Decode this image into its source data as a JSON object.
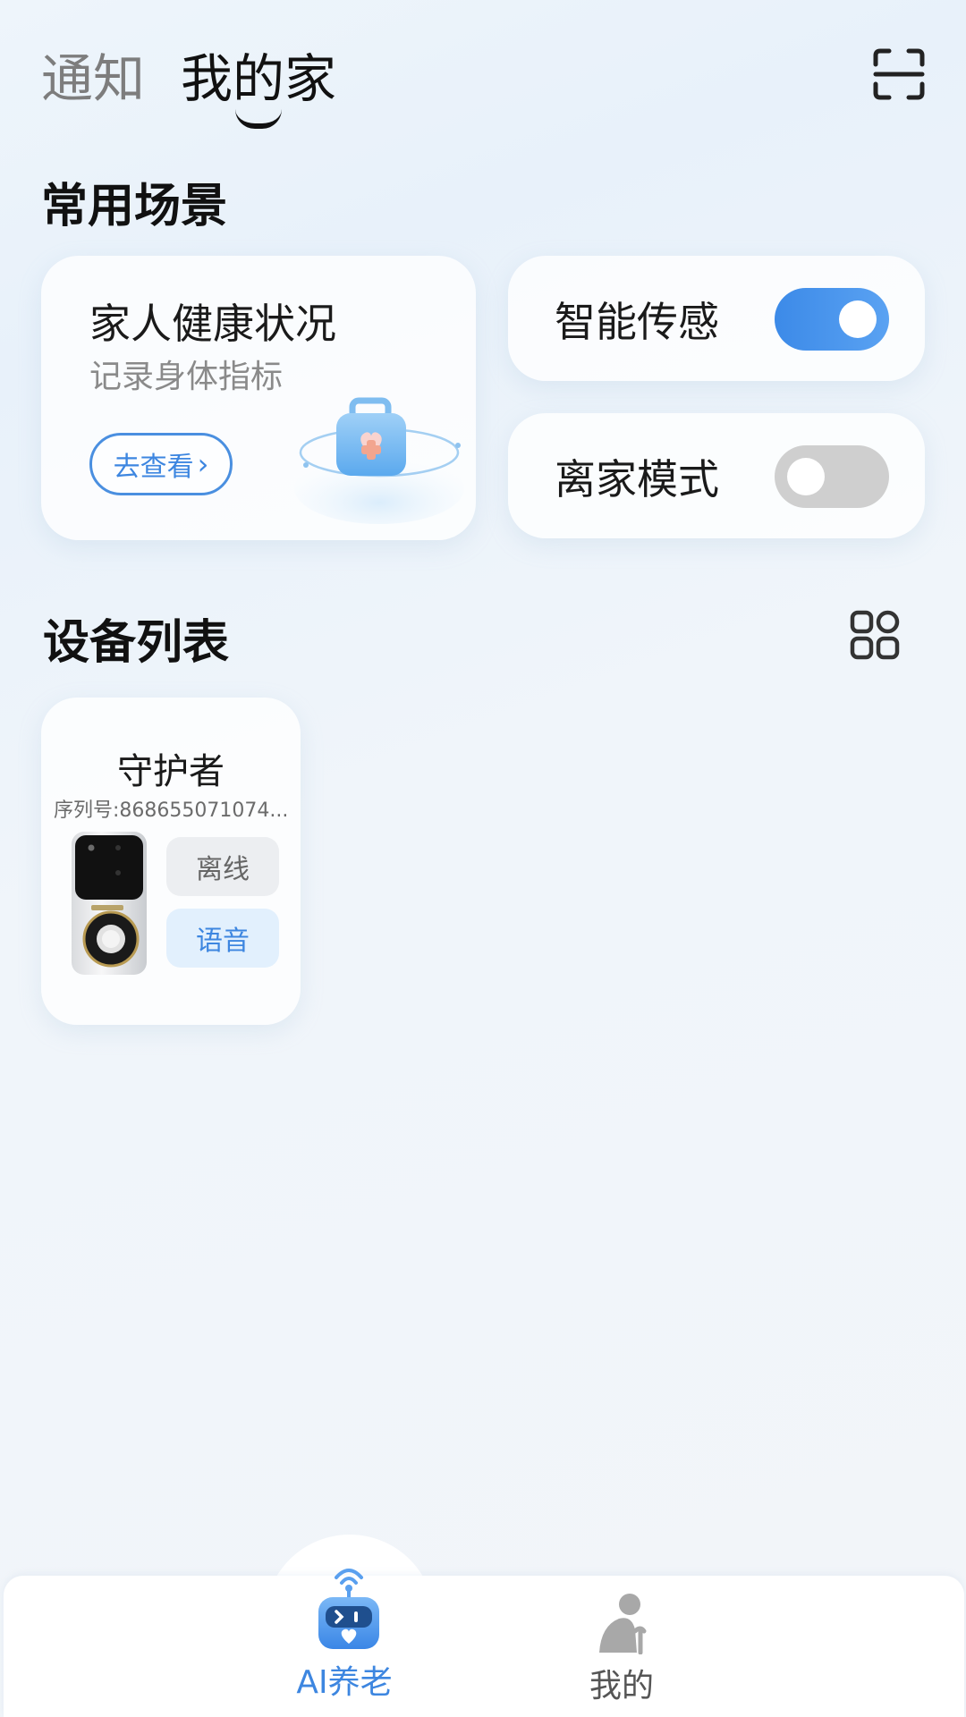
{
  "header": {
    "tab_notify": "通知",
    "tab_home": "我的家",
    "scan_icon": "scan-icon"
  },
  "scenes": {
    "title": "常用场景",
    "health_card": {
      "title": "家人健康状况",
      "subtitle": "记录身体指标",
      "button_label": "去查看",
      "illustration_icon": "medical-kit-icon"
    },
    "switches": [
      {
        "label": "智能传感",
        "state": "on"
      },
      {
        "label": "离家模式",
        "state": "off"
      }
    ]
  },
  "devices": {
    "title": "设备列表",
    "layout_icon": "grid-view-icon",
    "items": [
      {
        "name": "守护者",
        "serial": "序列号:868655071074...",
        "status": "离线",
        "voice_label": "语音",
        "image_icon": "doorbell-camera-icon"
      }
    ]
  },
  "bottom_nav": {
    "items": [
      {
        "label": "AI养老",
        "icon": "robot-icon",
        "active": true
      },
      {
        "label": "我的",
        "icon": "elder-person-icon",
        "active": false
      }
    ]
  },
  "colors": {
    "accent": "#3d86e0",
    "switch_on": "#4a95ec",
    "switch_off": "#cfcfcf",
    "status_offline_bg": "#eceef1",
    "voice_bg": "#e2f0fd"
  }
}
